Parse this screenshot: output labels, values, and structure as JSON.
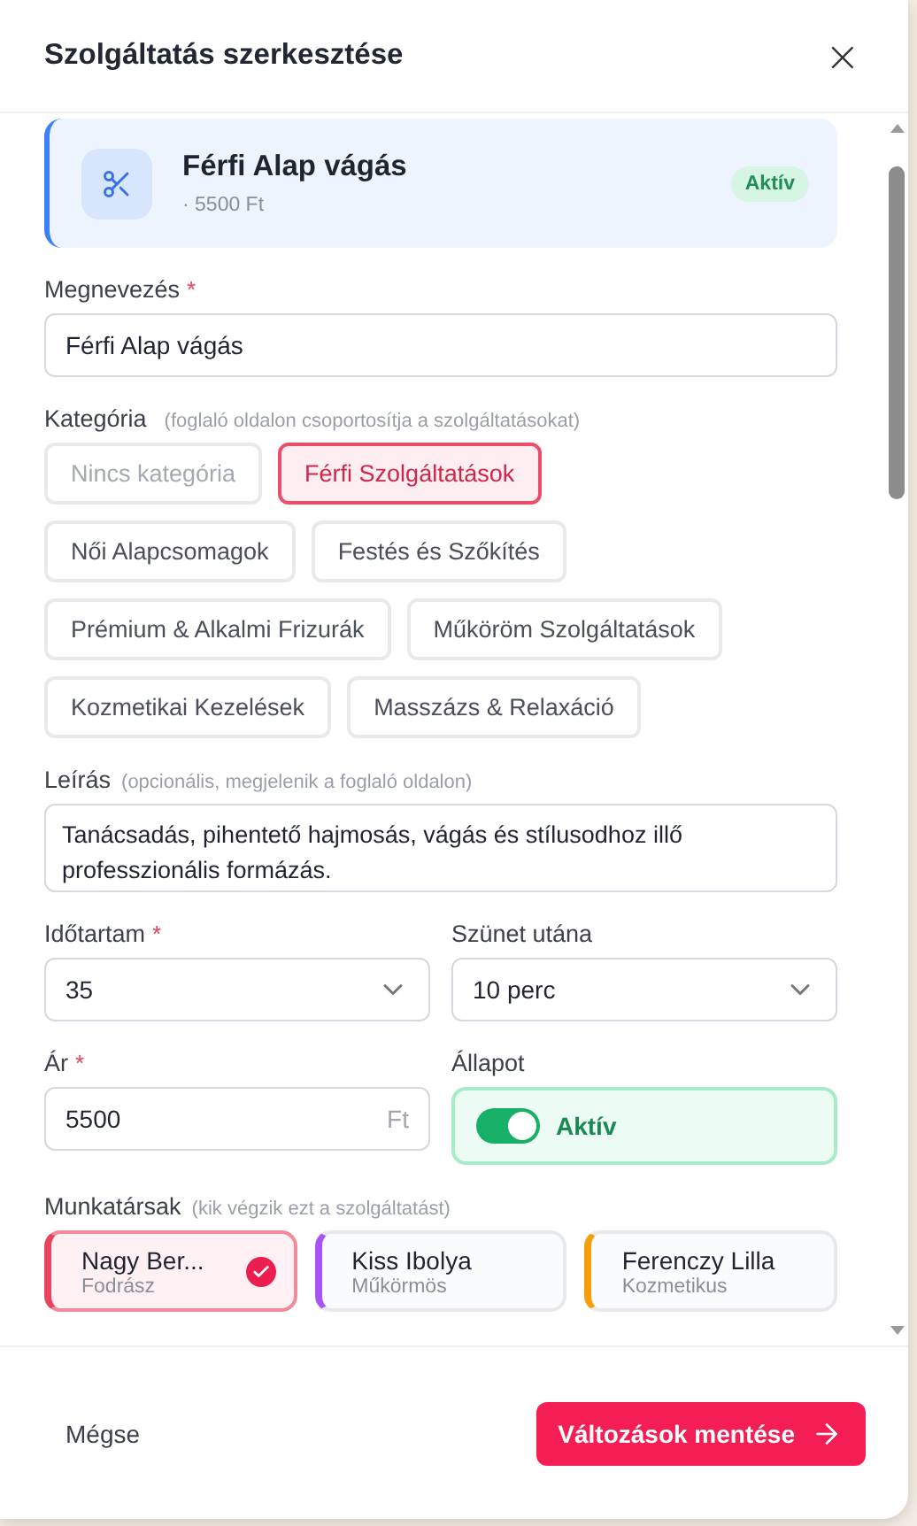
{
  "dialog": {
    "title": "Szolgáltatás szerkesztése",
    "close": "×"
  },
  "summary": {
    "title": "Férfi Alap vágás",
    "subtitle": "· 5500 Ft",
    "badge": "Aktív"
  },
  "name_field": {
    "label": "Megnevezés",
    "required_mark": "*",
    "value": "Férfi Alap vágás"
  },
  "category": {
    "label": "Kategória",
    "hint": "(foglaló oldalon csoportosítja a szolgáltatásokat)",
    "rows": [
      {
        "chips": [
          {
            "label": "Nincs kategória",
            "selected": false,
            "muted": true
          },
          {
            "label": "Férfi Szolgáltatások",
            "selected": true,
            "muted": false
          }
        ]
      },
      {
        "chips": [
          {
            "label": "Női Alapcsomagok",
            "selected": false,
            "muted": false
          },
          {
            "label": "Festés és Szőkítés",
            "selected": false,
            "muted": false
          }
        ]
      },
      {
        "chips": [
          {
            "label": "Prémium & Alkalmi Frizurák",
            "selected": false,
            "muted": false
          },
          {
            "label": "Műköröm Szolgáltatások",
            "selected": false,
            "muted": false
          }
        ]
      },
      {
        "chips": [
          {
            "label": "Kozmetikai Kezelések",
            "selected": false,
            "muted": false
          },
          {
            "label": "Masszázs & Relaxáció",
            "selected": false,
            "muted": false
          }
        ]
      }
    ]
  },
  "description": {
    "label": "Leírás",
    "hint": "(opcionális, megjelenik a foglaló oldalon)",
    "value": "Tanácsadás, pihentető hajmosás, vágás és stílusodhoz illő professzionális formázás."
  },
  "duration": {
    "label": "Időtartam",
    "required_mark": "*",
    "value": "35"
  },
  "break_after": {
    "label": "Szünet utána",
    "value": "10 perc"
  },
  "price": {
    "label": "Ár",
    "required_mark": "*",
    "value": "5500",
    "unit": "Ft"
  },
  "status": {
    "label": "Állapot",
    "on": true,
    "text": "Aktív"
  },
  "staff": {
    "label": "Munkatársak",
    "hint": "(kik végzik ezt a szolgáltatást)",
    "members": [
      {
        "name": "Nagy Ber...",
        "role": "Fodrász",
        "selected": true,
        "color": "#e8435f"
      },
      {
        "name": "Kiss Ibolya",
        "role": "Műkörmös",
        "selected": false,
        "color": "#a855f7"
      },
      {
        "name": "Ferenczy Lilla",
        "role": "Kozmetikus",
        "selected": false,
        "color": "#f59e0b"
      }
    ]
  },
  "footer": {
    "cancel": "Mégse",
    "save": "Változások mentése"
  }
}
